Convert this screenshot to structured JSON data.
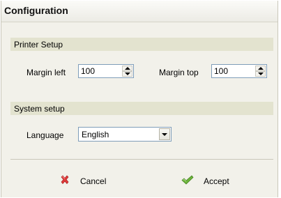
{
  "dialog": {
    "title": "Configuration"
  },
  "printer_setup": {
    "heading": "Printer Setup",
    "margin_left_label": "Margin left",
    "margin_left_value": "100",
    "margin_top_label": "Margin top",
    "margin_top_value": "100"
  },
  "system_setup": {
    "heading": "System setup",
    "language_label": "Language",
    "language_value": "English"
  },
  "actions": {
    "cancel_label": "Cancel",
    "accept_label": "Accept"
  },
  "colors": {
    "dialog_bg": "#f2f1ea",
    "section_bg": "#e3e3cf",
    "input_border": "#7f9db9",
    "cancel_icon": "#e03a3a",
    "accept_icon": "#6cb43a"
  },
  "icons": {
    "cancel": "red-x-icon",
    "accept": "green-check-icon"
  }
}
